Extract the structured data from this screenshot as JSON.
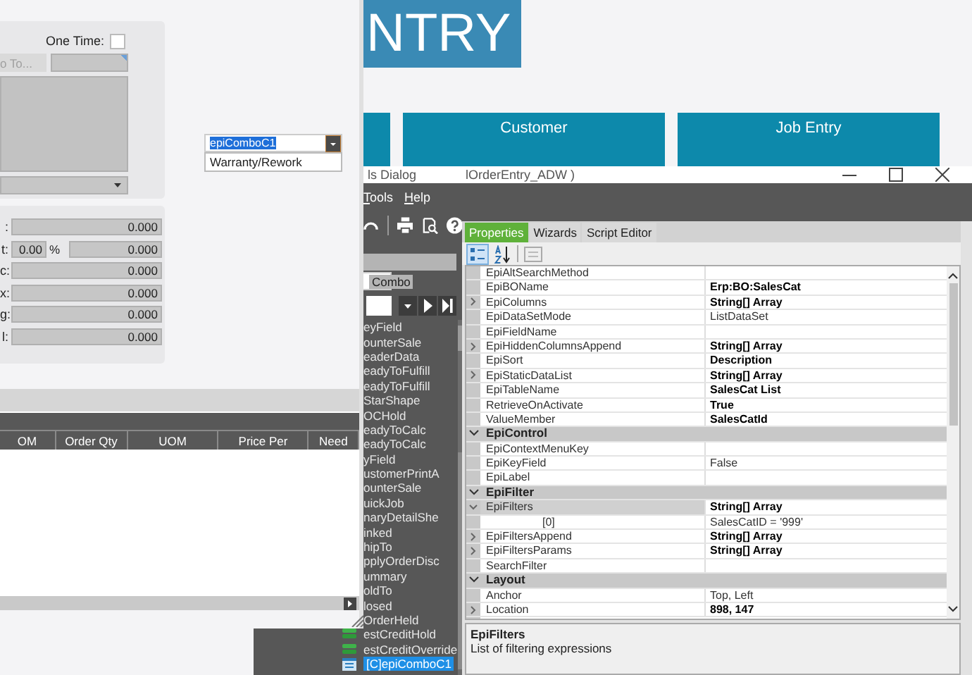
{
  "app": {
    "banner_title": "NTRY",
    "tiles": [
      {
        "label": "Customer"
      },
      {
        "label": "Job Entry"
      }
    ]
  },
  "order_form": {
    "one_time": {
      "label": "One Time:",
      "checked": false
    },
    "ship_to_button": {
      "label": "o To...",
      "disabled": true
    },
    "totals": [
      {
        "label": ":",
        "value": "0.000"
      },
      {
        "label": "t:",
        "percent": "0.00",
        "percent_sign": "%",
        "value": "0.000"
      },
      {
        "label": "c:",
        "value": "0.000"
      },
      {
        "label": "x:",
        "value": "0.000"
      },
      {
        "label": "g:",
        "value": "0.000"
      },
      {
        "label": "l:",
        "value": "0.000"
      }
    ],
    "combo": {
      "value": "epiComboC1",
      "options": [
        "Warranty/Rework"
      ]
    },
    "grid": {
      "columns": [
        "OM",
        "Order Qty",
        "UOM",
        "Price Per",
        "Need"
      ]
    }
  },
  "dialog": {
    "title_start": "ls Dialog",
    "title_end": "lOrderEntry_ADW )",
    "menu": [
      "Tools",
      "Help"
    ],
    "tree": {
      "header": "Combo",
      "items": [
        {
          "label": "eyField",
          "kind": "plain",
          "selected": false
        },
        {
          "label": "ounterSale",
          "kind": "plain",
          "selected": false
        },
        {
          "label": "eaderData",
          "kind": "plain",
          "selected": false
        },
        {
          "label": "eadyToFulfill",
          "kind": "plain",
          "selected": false
        },
        {
          "label": "eadyToFulfill",
          "kind": "plain",
          "selected": false
        },
        {
          "label": "StarShape",
          "kind": "plain",
          "selected": false
        },
        {
          "label": "OCHold",
          "kind": "plain",
          "selected": false
        },
        {
          "label": "eadyToCalc",
          "kind": "plain",
          "selected": false
        },
        {
          "label": "eadyToCalc",
          "kind": "plain",
          "selected": false
        },
        {
          "label": "yField",
          "kind": "plain",
          "selected": false
        },
        {
          "label": "ustomerPrintA",
          "kind": "plain",
          "selected": false
        },
        {
          "label": "ounterSale",
          "kind": "plain",
          "selected": false
        },
        {
          "label": "uickJob",
          "kind": "plain",
          "selected": false
        },
        {
          "label": "naryDetailShe",
          "kind": "plain",
          "selected": false
        },
        {
          "label": "inked",
          "kind": "plain",
          "selected": false
        },
        {
          "label": "hipTo",
          "kind": "plain",
          "selected": false
        },
        {
          "label": "pplyOrderDisc",
          "kind": "plain",
          "selected": false
        },
        {
          "label": "ummary",
          "kind": "plain",
          "selected": false
        },
        {
          "label": "oldTo",
          "kind": "plain",
          "selected": false
        },
        {
          "label": "losed",
          "kind": "plain",
          "selected": false
        },
        {
          "label": "OrderHeld",
          "kind": "plain",
          "selected": false
        },
        {
          "label": "estCreditHold",
          "kind": "field",
          "selected": false
        },
        {
          "label": "estCreditOverride",
          "kind": "field",
          "selected": false
        },
        {
          "label": "[C]epiComboC1",
          "kind": "control",
          "selected": true
        }
      ]
    },
    "tabs": [
      {
        "label": "Properties",
        "selected": true
      },
      {
        "label": "Wizards",
        "selected": false
      },
      {
        "label": "Script Editor",
        "selected": false
      }
    ],
    "properties": [
      {
        "kind": "property",
        "name": "EpiAltSearchMethod",
        "selected": false
      },
      {
        "kind": "property",
        "name": "EpiBOName",
        "value": "Erp:BO:SalesCat",
        "selected": false,
        "modified": true
      },
      {
        "kind": "property",
        "name": "EpiColumns",
        "value": "String[] Array",
        "selected": false,
        "modified": true,
        "expanded": false
      },
      {
        "kind": "property",
        "name": "EpiDataSetMode",
        "value": "ListDataSet",
        "selected": false,
        "modified": false
      },
      {
        "kind": "property",
        "name": "EpiFieldName",
        "selected": false
      },
      {
        "kind": "property",
        "name": "EpiHiddenColumnsAppend",
        "value": "String[] Array",
        "selected": false,
        "modified": true,
        "expanded": false
      },
      {
        "kind": "property",
        "name": "EpiSort",
        "value": "Description",
        "selected": false,
        "modified": true
      },
      {
        "kind": "property",
        "name": "EpiStaticDataList",
        "value": "String[] Array",
        "selected": false,
        "modified": true,
        "expanded": false
      },
      {
        "kind": "property",
        "name": "EpiTableName",
        "value": "SalesCat List",
        "selected": false,
        "modified": true
      },
      {
        "kind": "property",
        "name": "RetrieveOnActivate",
        "value": "True",
        "selected": false,
        "modified": true
      },
      {
        "kind": "property",
        "name": "ValueMember",
        "value": "SalesCatId",
        "selected": false,
        "modified": true
      },
      {
        "kind": "category",
        "name": "EpiControl",
        "expanded": true
      },
      {
        "kind": "property",
        "name": "EpiContextMenuKey",
        "selected": false
      },
      {
        "kind": "property",
        "name": "EpiKeyField",
        "value": "False",
        "selected": false,
        "modified": false
      },
      {
        "kind": "property",
        "name": "EpiLabel",
        "selected": false
      },
      {
        "kind": "category",
        "name": "EpiFilter",
        "expanded": true
      },
      {
        "kind": "property",
        "name": "EpiFilters",
        "value": "String[] Array",
        "selected": true,
        "modified": true,
        "expanded": true,
        "children": [
          {
            "kind": "property",
            "name": "[0]",
            "value": "SalesCatID = '999'",
            "selected": false,
            "modified": false
          }
        ]
      },
      {
        "kind": "property",
        "name": "EpiFiltersAppend",
        "value": "String[] Array",
        "selected": false,
        "modified": true,
        "expanded": false
      },
      {
        "kind": "property",
        "name": "EpiFiltersParams",
        "value": "String[] Array",
        "selected": false,
        "modified": true,
        "expanded": false
      },
      {
        "kind": "property",
        "name": "SearchFilter",
        "selected": false
      },
      {
        "kind": "category",
        "name": "Layout",
        "expanded": true
      },
      {
        "kind": "property",
        "name": "Anchor",
        "value": "Top, Left",
        "selected": false,
        "modified": false
      },
      {
        "kind": "property",
        "name": "Location",
        "value": "898, 147",
        "selected": false,
        "modified": true,
        "expanded": false
      }
    ],
    "description": {
      "title": "EpiFilters",
      "text": "List of filtering expressions"
    }
  }
}
